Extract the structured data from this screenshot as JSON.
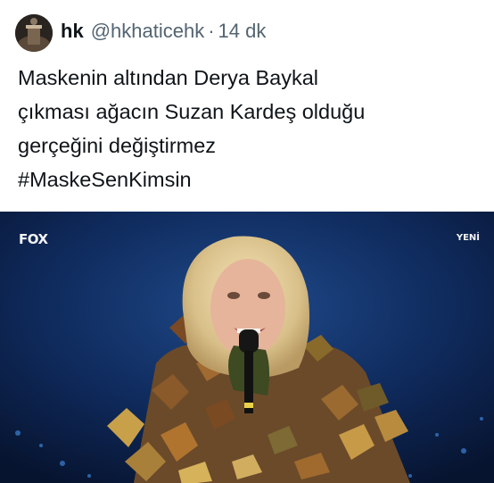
{
  "tweet": {
    "author_name": "hk",
    "author_handle": "@hkhaticehk",
    "separator": "·",
    "time_ago": "14 dk",
    "text_lines": [
      "Maskenin altından Derya Baykal",
      "çıkması ağacın Suzan Kardeş olduğu",
      "gerçeğini değiştirmez",
      "#MaskeSenKimsin"
    ]
  },
  "media": {
    "channel_logo": "FOX",
    "badge": "YENİ"
  },
  "icons": {
    "avatar": "profile-avatar"
  },
  "colors": {
    "text_primary": "#0f1419",
    "text_secondary": "#536471",
    "stage_blue": "#0b1a3a"
  }
}
